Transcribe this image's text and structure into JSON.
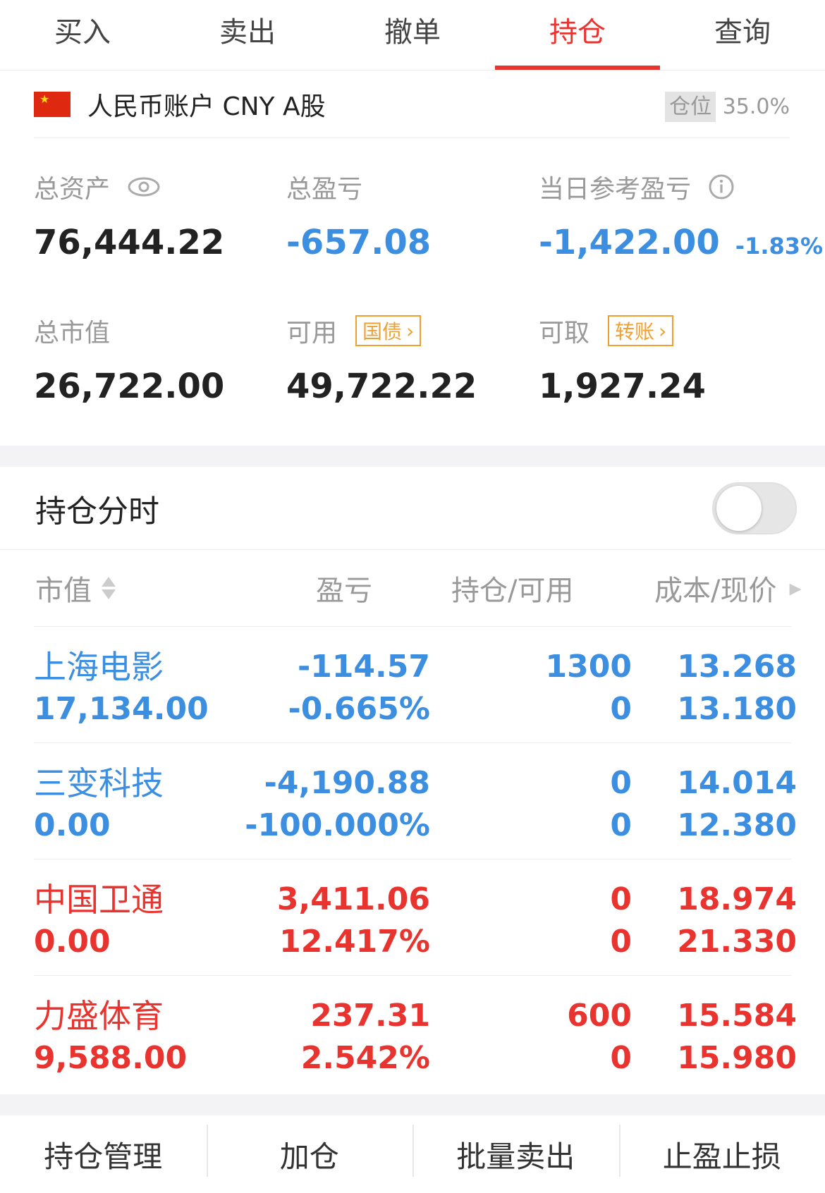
{
  "tabs": [
    {
      "label": "买入",
      "active": false
    },
    {
      "label": "卖出",
      "active": false
    },
    {
      "label": "撤单",
      "active": false
    },
    {
      "label": "持仓",
      "active": true
    },
    {
      "label": "查询",
      "active": false
    }
  ],
  "account": {
    "name": "人民币账户 CNY A股",
    "position_label": "仓位",
    "position_value": "35.0%"
  },
  "stats": {
    "total_assets_label": "总资产",
    "total_assets": "76,444.22",
    "total_pnl_label": "总盈亏",
    "total_pnl": "-657.08",
    "daily_pnl_label": "当日参考盈亏",
    "daily_pnl": "-1,422.00",
    "daily_pnl_pct": "-1.83%",
    "market_value_label": "总市值",
    "market_value": "26,722.00",
    "available_label": "可用",
    "available_badge": "国债",
    "available": "49,722.22",
    "withdrawable_label": "可取",
    "withdrawable_badge": "转账",
    "withdrawable": "1,927.24"
  },
  "holdings": {
    "title": "持仓分时",
    "toggle_on": false,
    "columns": [
      "市值",
      "盈亏",
      "持仓/可用",
      "成本/现价"
    ],
    "rows": [
      {
        "name": "上海电影",
        "market_value": "17,134.00",
        "pnl": "-114.57",
        "pnl_pct": "-0.665%",
        "position": "1300",
        "available": "0",
        "cost": "13.268",
        "price": "13.180",
        "color": "#3b8ee0"
      },
      {
        "name": "三变科技",
        "market_value": "0.00",
        "pnl": "-4,190.88",
        "pnl_pct": "-100.000%",
        "position": "0",
        "available": "0",
        "cost": "14.014",
        "price": "12.380",
        "color": "#3b8ee0"
      },
      {
        "name": "中国卫通",
        "market_value": "0.00",
        "pnl": "3,411.06",
        "pnl_pct": "12.417%",
        "position": "0",
        "available": "0",
        "cost": "18.974",
        "price": "21.330",
        "color": "#e8332f"
      },
      {
        "name": "力盛体育",
        "market_value": "9,588.00",
        "pnl": "237.31",
        "pnl_pct": "2.542%",
        "position": "600",
        "available": "0",
        "cost": "15.584",
        "price": "15.980",
        "color": "#e8332f"
      }
    ]
  },
  "bottom_actions": [
    "持仓管理",
    "加仓",
    "批量卖出",
    "止盈止损"
  ]
}
